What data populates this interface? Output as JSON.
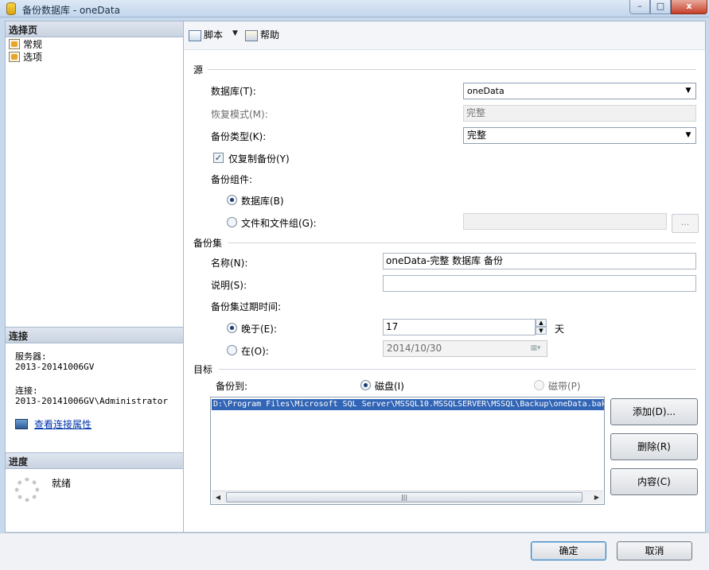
{
  "window": {
    "title": "备份数据库 - oneData",
    "minimize_label": "–",
    "maximize_label": "□",
    "close_label": "x"
  },
  "left": {
    "select_page_header": "选择页",
    "pages": [
      "常规",
      "选项"
    ],
    "connection_header": "连接",
    "server_label": "服务器:",
    "server_value": "2013-20141006GV",
    "connection_label": "连接:",
    "connection_value": "2013-20141006GV\\Administrator",
    "view_connection_properties": "查看连接属性",
    "progress_header": "进度",
    "progress_status": "就绪"
  },
  "toolbar": {
    "script_label": "脚本",
    "help_label": "帮助"
  },
  "source": {
    "group_label": "源",
    "database_label": "数据库(T):",
    "database_value": "oneData",
    "recovery_model_label": "恢复模式(M):",
    "recovery_model_value": "完整",
    "backup_type_label": "备份类型(K):",
    "backup_type_value": "完整",
    "copy_only_label": "仅复制备份(Y)",
    "copy_only_checked": true,
    "backup_component_label": "备份组件:",
    "component_database_label": "数据库(B)",
    "component_files_label": "文件和文件组(G):",
    "files_value": "",
    "browse_label": "..."
  },
  "backup_set": {
    "group_label": "备份集",
    "name_label": "名称(N):",
    "name_value": "oneData-完整 数据库 备份",
    "description_label": "说明(S):",
    "description_value": "",
    "expiry_label": "备份集过期时间:",
    "after_label": "晚于(E):",
    "after_value": "17",
    "after_unit": "天",
    "on_label": "在(O):",
    "on_value": "2014/10/30"
  },
  "destination": {
    "group_label": "目标",
    "backup_to_label": "备份到:",
    "disk_label": "磁盘(I)",
    "tape_label": "磁带(P)",
    "paths": [
      "D:\\Program Files\\Microsoft SQL Server\\MSSQL10.MSSQLSERVER\\MSSQL\\Backup\\oneData.bak"
    ],
    "add_label": "添加(D)...",
    "remove_label": "删除(R)",
    "contents_label": "内容(C)"
  },
  "footer": {
    "ok_label": "确定",
    "cancel_label": "取消"
  },
  "colors": {
    "selection": "#3265b5",
    "link": "#0033aa",
    "window_frame": "#c8d9ec"
  }
}
